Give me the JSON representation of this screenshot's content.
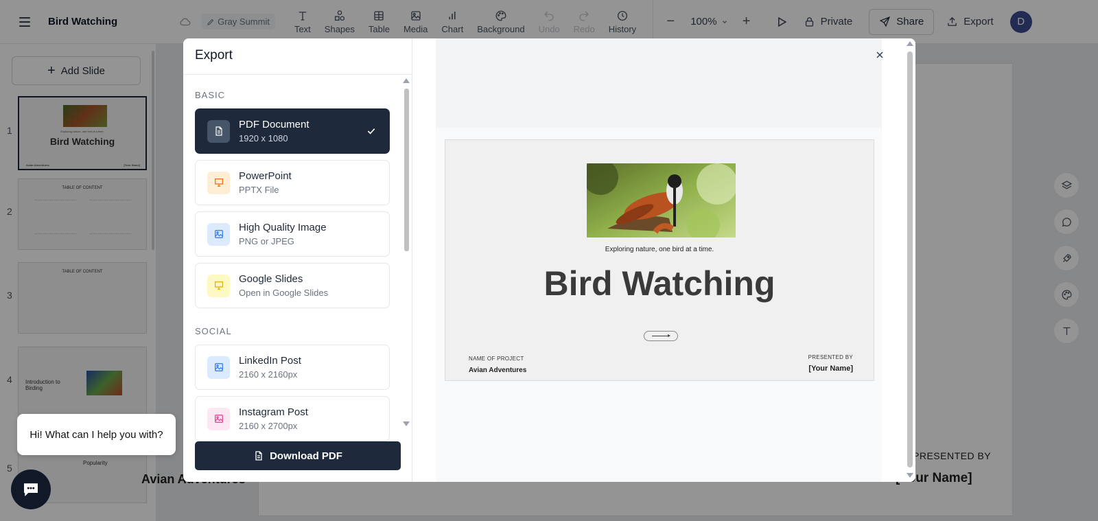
{
  "app": {
    "title": "Bird Watching",
    "theme_name": "Gray Summit"
  },
  "toolbar": {
    "tools": [
      {
        "label": "Text",
        "icon": "text-icon"
      },
      {
        "label": "Shapes",
        "icon": "shapes-icon"
      },
      {
        "label": "Table",
        "icon": "table-icon"
      },
      {
        "label": "Media",
        "icon": "media-icon"
      },
      {
        "label": "Chart",
        "icon": "chart-icon"
      },
      {
        "label": "Background",
        "icon": "palette-icon"
      },
      {
        "label": "Undo",
        "icon": "undo-icon"
      },
      {
        "label": "Redo",
        "icon": "redo-icon"
      },
      {
        "label": "History",
        "icon": "clock-icon"
      }
    ],
    "zoom": "100%",
    "privacy_label": "Private",
    "share_label": "Share",
    "export_label": "Export",
    "avatar_initial": "D"
  },
  "sidebar": {
    "add_slide_label": "Add Slide",
    "slides": [
      {
        "number": "1",
        "title": "Bird Watching",
        "tagline": "Exploring nature, one bird at a time.",
        "footer_left": "Avian Adventures",
        "footer_right": "[Your Name]"
      },
      {
        "number": "2",
        "title": "TABLE OF CONTENT"
      },
      {
        "number": "3",
        "title": "TABLE OF CONTENT"
      },
      {
        "number": "4",
        "title": "Introduction to Birding"
      },
      {
        "number": "5",
        "title": "Popularity"
      }
    ]
  },
  "canvas_bg": {
    "project_name": "Avian Adventures",
    "presented_by": "PRESENTED BY",
    "your_name": "[Your Name]"
  },
  "export_modal": {
    "title": "Export",
    "sections": [
      {
        "label": "BASIC",
        "options": [
          {
            "name": "PDF Document",
            "sub": "1920 x 1080",
            "selected": true
          },
          {
            "name": "PowerPoint",
            "sub": "PPTX File"
          },
          {
            "name": "High Quality Image",
            "sub": "PNG or JPEG"
          },
          {
            "name": "Google Slides",
            "sub": "Open in Google Slides"
          }
        ]
      },
      {
        "label": "SOCIAL",
        "options": [
          {
            "name": "LinkedIn Post",
            "sub": "2160 x 2160px"
          },
          {
            "name": "Instagram Post",
            "sub": "2160 x 2700px"
          }
        ]
      }
    ],
    "download_label": "Download PDF",
    "preview": {
      "tagline": "Exploring nature, one bird at a time.",
      "title": "Bird Watching",
      "name_of_project_label": "NAME OF PROJECT",
      "project_name": "Avian Adventures",
      "presented_by_label": "PRESENTED BY",
      "presenter": "[Your Name]"
    }
  },
  "chat": {
    "greeting": "Hi! What can I help you with?"
  },
  "colors": {
    "primary_dark": "#1e293b",
    "powerpoint_accent": "#f97316",
    "image_accent": "#3b82f6",
    "google_accent": "#eab308",
    "instagram_accent": "#ec4899",
    "avatar": "#3b4a8c"
  }
}
